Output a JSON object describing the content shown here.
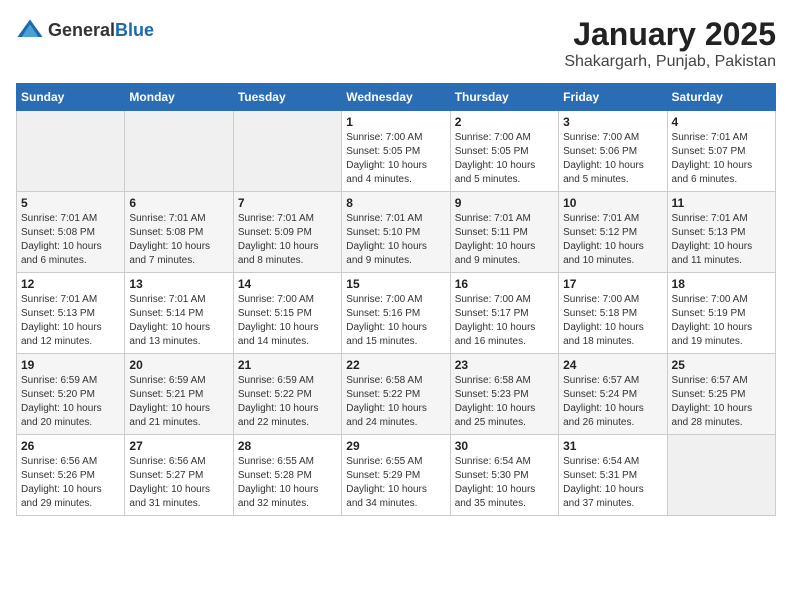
{
  "header": {
    "logo_general": "General",
    "logo_blue": "Blue",
    "month_year": "January 2025",
    "location": "Shakargarh, Punjab, Pakistan"
  },
  "days_of_week": [
    "Sunday",
    "Monday",
    "Tuesday",
    "Wednesday",
    "Thursday",
    "Friday",
    "Saturday"
  ],
  "weeks": [
    [
      {
        "day": "",
        "info": ""
      },
      {
        "day": "",
        "info": ""
      },
      {
        "day": "",
        "info": ""
      },
      {
        "day": "1",
        "info": "Sunrise: 7:00 AM\nSunset: 5:05 PM\nDaylight: 10 hours\nand 4 minutes."
      },
      {
        "day": "2",
        "info": "Sunrise: 7:00 AM\nSunset: 5:05 PM\nDaylight: 10 hours\nand 5 minutes."
      },
      {
        "day": "3",
        "info": "Sunrise: 7:00 AM\nSunset: 5:06 PM\nDaylight: 10 hours\nand 5 minutes."
      },
      {
        "day": "4",
        "info": "Sunrise: 7:01 AM\nSunset: 5:07 PM\nDaylight: 10 hours\nand 6 minutes."
      }
    ],
    [
      {
        "day": "5",
        "info": "Sunrise: 7:01 AM\nSunset: 5:08 PM\nDaylight: 10 hours\nand 6 minutes."
      },
      {
        "day": "6",
        "info": "Sunrise: 7:01 AM\nSunset: 5:08 PM\nDaylight: 10 hours\nand 7 minutes."
      },
      {
        "day": "7",
        "info": "Sunrise: 7:01 AM\nSunset: 5:09 PM\nDaylight: 10 hours\nand 8 minutes."
      },
      {
        "day": "8",
        "info": "Sunrise: 7:01 AM\nSunset: 5:10 PM\nDaylight: 10 hours\nand 9 minutes."
      },
      {
        "day": "9",
        "info": "Sunrise: 7:01 AM\nSunset: 5:11 PM\nDaylight: 10 hours\nand 9 minutes."
      },
      {
        "day": "10",
        "info": "Sunrise: 7:01 AM\nSunset: 5:12 PM\nDaylight: 10 hours\nand 10 minutes."
      },
      {
        "day": "11",
        "info": "Sunrise: 7:01 AM\nSunset: 5:13 PM\nDaylight: 10 hours\nand 11 minutes."
      }
    ],
    [
      {
        "day": "12",
        "info": "Sunrise: 7:01 AM\nSunset: 5:13 PM\nDaylight: 10 hours\nand 12 minutes."
      },
      {
        "day": "13",
        "info": "Sunrise: 7:01 AM\nSunset: 5:14 PM\nDaylight: 10 hours\nand 13 minutes."
      },
      {
        "day": "14",
        "info": "Sunrise: 7:00 AM\nSunset: 5:15 PM\nDaylight: 10 hours\nand 14 minutes."
      },
      {
        "day": "15",
        "info": "Sunrise: 7:00 AM\nSunset: 5:16 PM\nDaylight: 10 hours\nand 15 minutes."
      },
      {
        "day": "16",
        "info": "Sunrise: 7:00 AM\nSunset: 5:17 PM\nDaylight: 10 hours\nand 16 minutes."
      },
      {
        "day": "17",
        "info": "Sunrise: 7:00 AM\nSunset: 5:18 PM\nDaylight: 10 hours\nand 18 minutes."
      },
      {
        "day": "18",
        "info": "Sunrise: 7:00 AM\nSunset: 5:19 PM\nDaylight: 10 hours\nand 19 minutes."
      }
    ],
    [
      {
        "day": "19",
        "info": "Sunrise: 6:59 AM\nSunset: 5:20 PM\nDaylight: 10 hours\nand 20 minutes."
      },
      {
        "day": "20",
        "info": "Sunrise: 6:59 AM\nSunset: 5:21 PM\nDaylight: 10 hours\nand 21 minutes."
      },
      {
        "day": "21",
        "info": "Sunrise: 6:59 AM\nSunset: 5:22 PM\nDaylight: 10 hours\nand 22 minutes."
      },
      {
        "day": "22",
        "info": "Sunrise: 6:58 AM\nSunset: 5:22 PM\nDaylight: 10 hours\nand 24 minutes."
      },
      {
        "day": "23",
        "info": "Sunrise: 6:58 AM\nSunset: 5:23 PM\nDaylight: 10 hours\nand 25 minutes."
      },
      {
        "day": "24",
        "info": "Sunrise: 6:57 AM\nSunset: 5:24 PM\nDaylight: 10 hours\nand 26 minutes."
      },
      {
        "day": "25",
        "info": "Sunrise: 6:57 AM\nSunset: 5:25 PM\nDaylight: 10 hours\nand 28 minutes."
      }
    ],
    [
      {
        "day": "26",
        "info": "Sunrise: 6:56 AM\nSunset: 5:26 PM\nDaylight: 10 hours\nand 29 minutes."
      },
      {
        "day": "27",
        "info": "Sunrise: 6:56 AM\nSunset: 5:27 PM\nDaylight: 10 hours\nand 31 minutes."
      },
      {
        "day": "28",
        "info": "Sunrise: 6:55 AM\nSunset: 5:28 PM\nDaylight: 10 hours\nand 32 minutes."
      },
      {
        "day": "29",
        "info": "Sunrise: 6:55 AM\nSunset: 5:29 PM\nDaylight: 10 hours\nand 34 minutes."
      },
      {
        "day": "30",
        "info": "Sunrise: 6:54 AM\nSunset: 5:30 PM\nDaylight: 10 hours\nand 35 minutes."
      },
      {
        "day": "31",
        "info": "Sunrise: 6:54 AM\nSunset: 5:31 PM\nDaylight: 10 hours\nand 37 minutes."
      },
      {
        "day": "",
        "info": ""
      }
    ]
  ]
}
